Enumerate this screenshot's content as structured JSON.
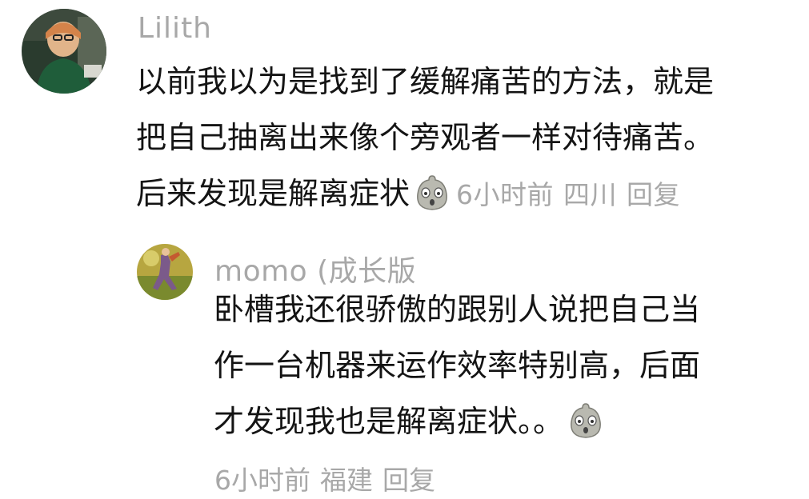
{
  "comments": [
    {
      "username": "Lilith",
      "lines": [
        "以前我以为是找到了缓解痛苦的方法，就是",
        "把自己抽离出来像个旁观者一样对待痛苦。",
        "后来发现是解离症状"
      ],
      "emoji": "shocked-face-emoji",
      "time": "6小时前",
      "location": "四川",
      "reply_label": "回复"
    },
    {
      "username": "momo (成长版",
      "lines": [
        "卧槽我还很骄傲的跟别人说把自己当",
        "作一台机器来运作效率特别高，后面",
        "才发现我也是解离症状。。"
      ],
      "emoji": "shocked-face-emoji",
      "time": "6小时前",
      "location": "福建",
      "reply_label": "回复"
    }
  ],
  "colors": {
    "text": "#141414",
    "meta": "#a8a8a8",
    "background": "#ffffff"
  }
}
